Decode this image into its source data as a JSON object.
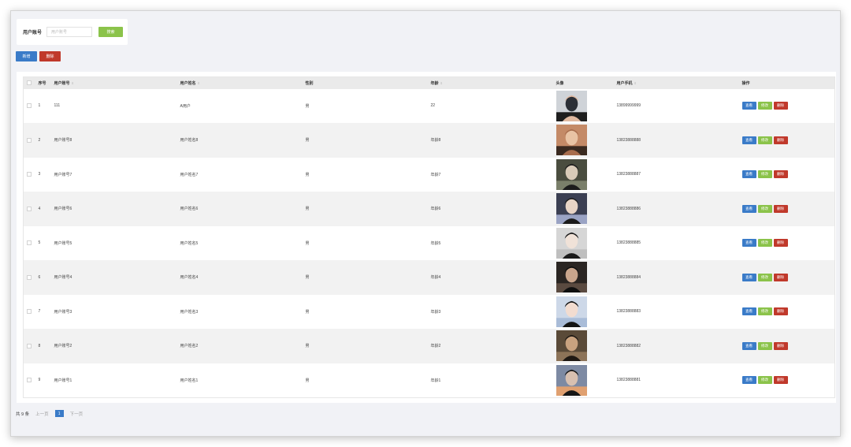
{
  "search": {
    "label": "用户账号",
    "placeholder": "用户账号",
    "value": "",
    "button_label": "搜索"
  },
  "actions": {
    "add_label": "新增",
    "delete_label": "删除"
  },
  "table": {
    "headers": {
      "index": "序号",
      "account": "用户账号",
      "name": "用户姓名",
      "gender": "性别",
      "age": "年龄",
      "avatar": "头像",
      "phone": "用户手机",
      "ops": "操作"
    },
    "sort_icon": "sort-arrows-icon",
    "rows": [
      {
        "index": "1",
        "account": "111",
        "name": "A用户",
        "gender": "男",
        "age": "22",
        "phone": "13899999999"
      },
      {
        "index": "2",
        "account": "用户账号8",
        "name": "用户姓名8",
        "gender": "男",
        "age": "年龄8",
        "phone": "13823888888"
      },
      {
        "index": "3",
        "account": "用户账号7",
        "name": "用户姓名7",
        "gender": "男",
        "age": "年龄7",
        "phone": "13823888887"
      },
      {
        "index": "4",
        "account": "用户账号6",
        "name": "用户姓名6",
        "gender": "男",
        "age": "年龄6",
        "phone": "13823888886"
      },
      {
        "index": "5",
        "account": "用户账号5",
        "name": "用户姓名5",
        "gender": "男",
        "age": "年龄5",
        "phone": "13823888885"
      },
      {
        "index": "6",
        "account": "用户账号4",
        "name": "用户姓名4",
        "gender": "男",
        "age": "年龄4",
        "phone": "13823888884"
      },
      {
        "index": "7",
        "account": "用户账号3",
        "name": "用户姓名3",
        "gender": "男",
        "age": "年龄3",
        "phone": "13823888883"
      },
      {
        "index": "8",
        "account": "用户账号2",
        "name": "用户姓名2",
        "gender": "男",
        "age": "年龄2",
        "phone": "13823888882"
      },
      {
        "index": "9",
        "account": "用户账号1",
        "name": "用户姓名1",
        "gender": "男",
        "age": "年龄1",
        "phone": "13823888881"
      }
    ],
    "row_actions": {
      "view_label": "查看",
      "edit_label": "修改",
      "delete_label": "删除"
    }
  },
  "pagination": {
    "total": "共 9 条",
    "prev": "上一页",
    "current": "1",
    "next": "下一页"
  },
  "colors": {
    "primary": "#3a7bc8",
    "success": "#8bc34a",
    "danger": "#c0392b",
    "background": "#f1f2f6"
  }
}
